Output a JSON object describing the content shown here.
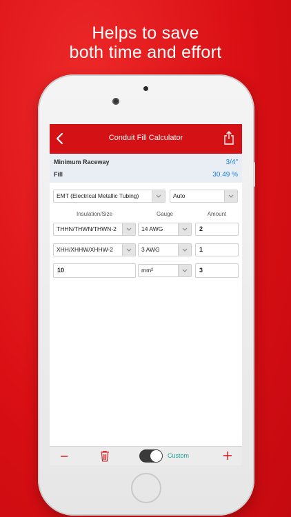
{
  "headline": {
    "line1": "Helps to save",
    "line2": "both time and effort"
  },
  "nav": {
    "title": "Conduit Fill Calculator",
    "back_icon": "chevron-left-icon",
    "share_icon": "share-icon"
  },
  "summary": {
    "raceway_label": "Minimum Raceway",
    "raceway_value": "3/4\"",
    "fill_label": "Fill",
    "fill_value": "30.49 %"
  },
  "conduit": {
    "type": "EMT (Electrical Metallic Tubing)",
    "size": "Auto"
  },
  "columns": {
    "insulation": "Insulation/Size",
    "gauge": "Gauge",
    "amount": "Amount"
  },
  "rows": [
    {
      "insulation": "THHN/THWN/THWN-2",
      "gauge": "14 AWG",
      "amount": "2"
    },
    {
      "insulation": "XHH/XHHW/XHHW-2",
      "gauge": "3 AWG",
      "amount": "1"
    },
    {
      "insulation": "10",
      "gauge": "mm²",
      "amount": "3"
    }
  ],
  "toolbar": {
    "toggle_label": "Custom",
    "toggle_on": true
  },
  "colors": {
    "brand_red": "#d41215",
    "accent_blue": "#1f7ee0",
    "toggle_teal": "#1aa29a"
  }
}
